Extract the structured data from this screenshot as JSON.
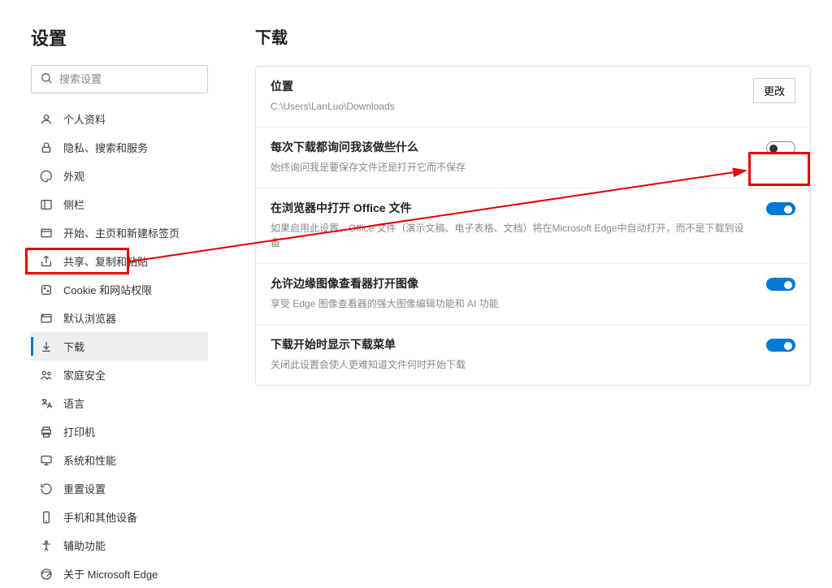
{
  "sidebar": {
    "title": "设置",
    "search_placeholder": "搜索设置",
    "items": [
      {
        "label": "个人资料"
      },
      {
        "label": "隐私、搜索和服务"
      },
      {
        "label": "外观"
      },
      {
        "label": "侧栏"
      },
      {
        "label": "开始、主页和新建标签页"
      },
      {
        "label": "共享、复制和粘贴"
      },
      {
        "label": "Cookie 和网站权限"
      },
      {
        "label": "默认浏览器"
      },
      {
        "label": "下载"
      },
      {
        "label": "家庭安全"
      },
      {
        "label": "语言"
      },
      {
        "label": "打印机"
      },
      {
        "label": "系统和性能"
      },
      {
        "label": "重置设置"
      },
      {
        "label": "手机和其他设备"
      },
      {
        "label": "辅助功能"
      },
      {
        "label": "关于 Microsoft Edge"
      }
    ]
  },
  "main": {
    "title": "下载",
    "rows": {
      "location": {
        "title": "位置",
        "desc": "C:\\Users\\LanLuo\\Downloads",
        "button": "更改"
      },
      "ask": {
        "title": "每次下载都询问我该做些什么",
        "desc": "始终询问我是要保存文件还是打开它而不保存",
        "state": "off"
      },
      "office": {
        "title": "在浏览器中打开 Office 文件",
        "desc": "如果启用此设置，Office 文件（演示文稿、电子表格、文档）将在Microsoft Edge中自动打开，而不是下载到设备",
        "state": "on"
      },
      "image": {
        "title": "允许边缘图像查看器打开图像",
        "desc": "享受 Edge 图像查看器的强大图像编辑功能和 AI 功能",
        "state": "on"
      },
      "menu": {
        "title": "下载开始时显示下载菜单",
        "desc": "关闭此设置会使人更难知道文件何时开始下载",
        "state": "on"
      }
    }
  }
}
